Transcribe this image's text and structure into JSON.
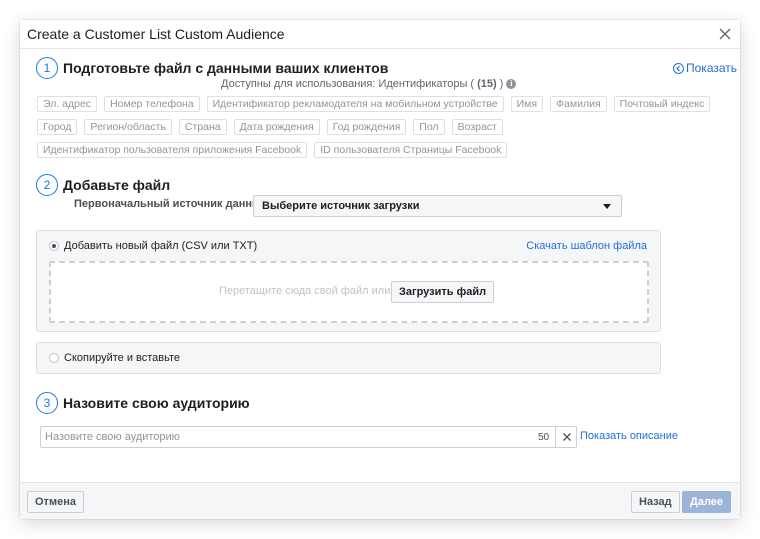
{
  "dialog": {
    "title": "Create a Customer List Custom Audience"
  },
  "step1": {
    "number": "1",
    "title": "Подготовьте файл с данными ваших клиентов",
    "show_link": "Показать",
    "available_prefix": "Доступны для использования: Идентификаторы (",
    "available_count": "(15)",
    "available_suffix": ")",
    "identifiers": [
      [
        "Эл. адрес",
        "Номер телефона",
        "Идентификатор рекламодателя на мобильном устройстве",
        "Имя",
        "Фамилия",
        "Почтовый индекс"
      ],
      [
        "Город",
        "Регион/область",
        "Страна",
        "Дата рождения",
        "Год рождения",
        "Пол",
        "Возраст"
      ],
      [
        "Идентификатор пользователя приложения Facebook",
        "ID пользователя Страницы Facebook"
      ]
    ]
  },
  "step2": {
    "number": "2",
    "title": "Добавьте файл",
    "source_label": "Первоначальный источник данных",
    "source_select": "Выберите источник загрузки",
    "option_new_file": "Добавить новый файл (CSV или TXT)",
    "template_link": "Скачать шаблон файла",
    "drop_text": "Перетащите сюда свой файл или",
    "upload_button": "Загрузить файл",
    "option_paste": "Скопируйте и вставьте"
  },
  "step3": {
    "number": "3",
    "title": "Назовите свою аудиторию",
    "name_placeholder": "Назовите свою аудиторию",
    "char_limit": "50",
    "show_description": "Показать описание"
  },
  "footer": {
    "cancel": "Отмена",
    "back": "Назад",
    "next": "Далее"
  },
  "colors": {
    "accent": "#1877f2",
    "link": "#216fdb",
    "next_disabled": "#9cb4d8"
  }
}
